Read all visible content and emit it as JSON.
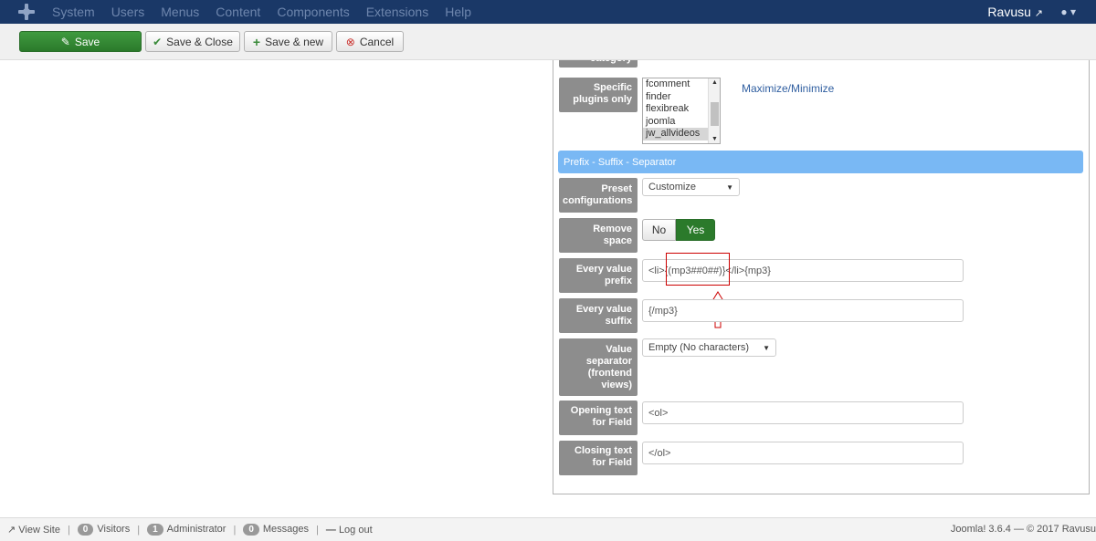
{
  "navbar": {
    "menu": [
      "System",
      "Users",
      "Menus",
      "Content",
      "Components",
      "Extensions",
      "Help"
    ],
    "user": "Ravusu"
  },
  "toolbar": {
    "save": "Save",
    "save_close": "Save & Close",
    "save_new": "Save & new",
    "cancel": "Cancel"
  },
  "form": {
    "cut_label": "category",
    "plugins_label": "Specific plugins only",
    "plugins_options": [
      "fcomment",
      "finder",
      "flexibreak",
      "joomla",
      "jw_allvideos"
    ],
    "plugins_selected": "jw_allvideos",
    "maximize_link": "Maximize/Minimize",
    "section_title": "Prefix - Suffix - Separator",
    "preset_label": "Preset configurations",
    "preset_value": "Customize",
    "remove_space_label": "Remove space",
    "remove_space_no": "No",
    "remove_space_yes": "Yes",
    "prefix_label": "Every value prefix",
    "prefix_value": "<li>{(mp3##0##)}</li>{mp3}",
    "suffix_label": "Every value suffix",
    "suffix_value": "{/mp3}",
    "separator_label": "Value separator (frontend views)",
    "separator_value": "Empty (No characters)",
    "opening_label": "Opening text for Field",
    "opening_value": "<ol>",
    "closing_label": "Closing text for Field",
    "closing_value": "</ol>"
  },
  "statusbar": {
    "view_site": "View Site",
    "visitors_count": "0",
    "visitors": "Visitors",
    "admin_count": "1",
    "admin": "Administrator",
    "messages_count": "0",
    "messages": "Messages",
    "logout": "Log out",
    "version": "Joomla! 3.6.4 — © 2017 Ravusu"
  },
  "colors": {
    "navbar": "#1a3867",
    "save": "#2b7a2b",
    "section": "#79b8f4",
    "label": "#8d8d8d",
    "highlight": "#cc0000"
  }
}
